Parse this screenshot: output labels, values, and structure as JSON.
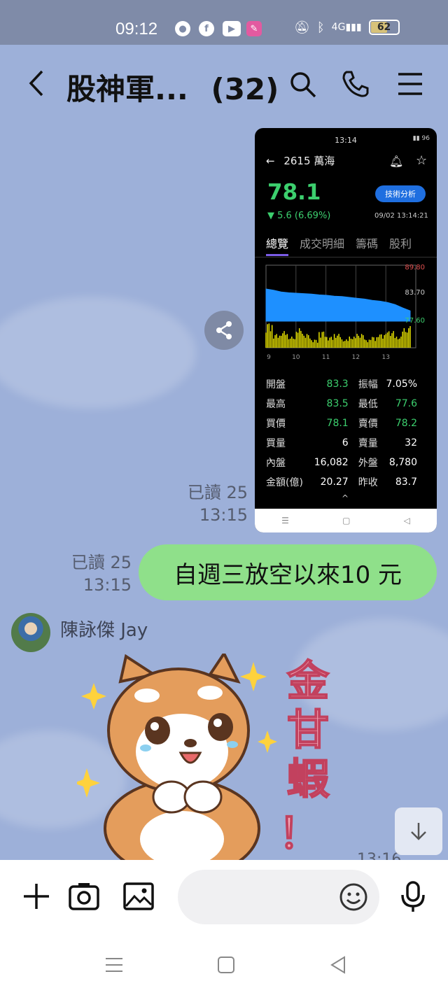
{
  "status_bar": {
    "time": "09:12",
    "network": "4G",
    "battery": "62",
    "battery_level_pct": 62
  },
  "header": {
    "title": "股神軍...",
    "member_count": "(32)"
  },
  "screenshot_msg": {
    "status_time": "13:14",
    "status_battery": "96",
    "stock_title": "2615 萬海",
    "price": "78.1",
    "change": "▼ 5.6 (6.69%)",
    "tech_button": "技術分析",
    "datetime": "09/02 13:14:21",
    "tabs": [
      "總覽",
      "成交明細",
      "籌碼",
      "股利"
    ],
    "stats": [
      [
        "開盤",
        "83.3",
        "振幅",
        "7.05%"
      ],
      [
        "最高",
        "83.5",
        "最低",
        "77.6"
      ],
      [
        "買價",
        "78.1",
        "賣價",
        "78.2"
      ],
      [
        "買量",
        "6",
        "賣量",
        "32"
      ],
      [
        "內盤",
        "16,082",
        "外盤",
        "8,780"
      ],
      [
        "金額(億)",
        "20.27",
        "昨收",
        "83.7"
      ]
    ],
    "caret": "^"
  },
  "chart_data": {
    "type": "area",
    "y_ticks": [
      "89.80",
      "83.70",
      "77.60"
    ],
    "x_ticks": [
      "9",
      "10",
      "11",
      "12",
      "13"
    ],
    "ylim": [
      77.6,
      89.8
    ],
    "price_series": [
      83.3,
      83.0,
      82.6,
      82.4,
      82.3,
      82.2,
      82.1,
      81.9,
      81.8,
      81.6,
      81.5,
      81.3,
      81.1,
      80.9,
      80.6,
      80.4,
      80.1,
      79.6,
      78.8,
      78.1
    ],
    "volume_series": [
      0.9,
      0.5,
      0.6,
      0.4,
      0.7,
      0.5,
      0.3,
      0.6,
      0.4,
      0.5,
      0.3,
      0.4,
      0.5,
      0.3,
      0.4,
      0.5,
      0.6,
      0.4,
      0.7,
      1.0
    ],
    "colors": {
      "price": "#1e90ff",
      "volume": "#e5e000",
      "up_tick": "#e05050",
      "down_tick": "#3ccf6e"
    }
  },
  "messages": {
    "read1": "已讀 25",
    "time1": "13:15",
    "read2": "已讀 25",
    "time2": "13:15",
    "bubble_text": "自週三放空以來10 元",
    "sender_name": "陳詠傑 Jay",
    "sticker_text": "金甘蝦！",
    "partial_time": "13:16"
  },
  "input_bar": {
    "placeholder": ""
  },
  "colors": {
    "chat_bg": "#9db0d9",
    "bubble": "#8fe08a",
    "status_bar": "#7f8ba8"
  }
}
